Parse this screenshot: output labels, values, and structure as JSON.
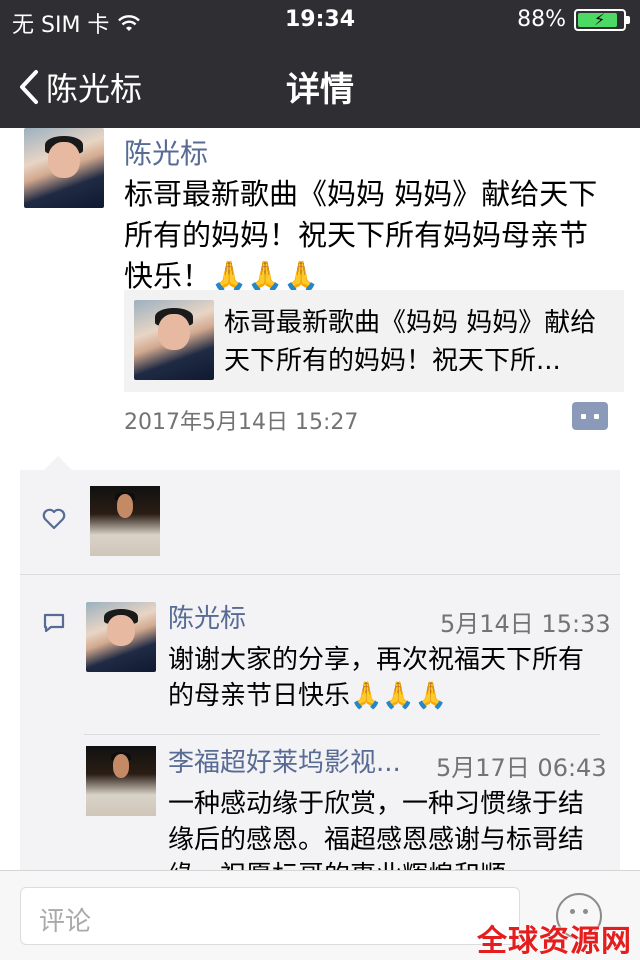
{
  "status_bar": {
    "carrier": "无 SIM 卡",
    "time": "19:34",
    "battery": "88%",
    "battery_level": 0.88
  },
  "nav": {
    "back_label": "陈光标",
    "title": "详情"
  },
  "post": {
    "author": "陈光标",
    "text": "标哥最新歌曲《妈妈 妈妈》献给天下所有的妈妈！祝天下所有妈妈母亲节快乐！🙏🙏🙏",
    "link_title": "标哥最新歌曲《妈妈 妈妈》献给天下所有的妈妈！祝天下所...",
    "timestamp": "2017年5月14日 15:27"
  },
  "comments": [
    {
      "author": "陈光标",
      "time": "5月14日 15:33",
      "text": "谢谢大家的分享，再次祝福天下所有的母亲节日快乐🙏🙏🙏"
    },
    {
      "author": "李福超好莱坞影视...",
      "time": "5月17日 06:43",
      "text": "一种感动缘于欣赏，一种习惯缘于结缘后的感恩。福超感恩感谢与标哥结缘，祝愿标哥的事业辉煌和顺"
    }
  ],
  "comment_input": {
    "placeholder": "评论"
  },
  "watermark": "全球资源网",
  "icons": {
    "back": "chevron-left-icon",
    "like": "heart-icon",
    "comment": "comment-icon",
    "wifi": "wifi-icon",
    "emoji": "emoji-icon"
  },
  "colors": {
    "nav_bg": "#2e2e33",
    "name_blue": "#576b95",
    "battery_green": "#4cd964",
    "watermark_red": "#e41e1e"
  }
}
